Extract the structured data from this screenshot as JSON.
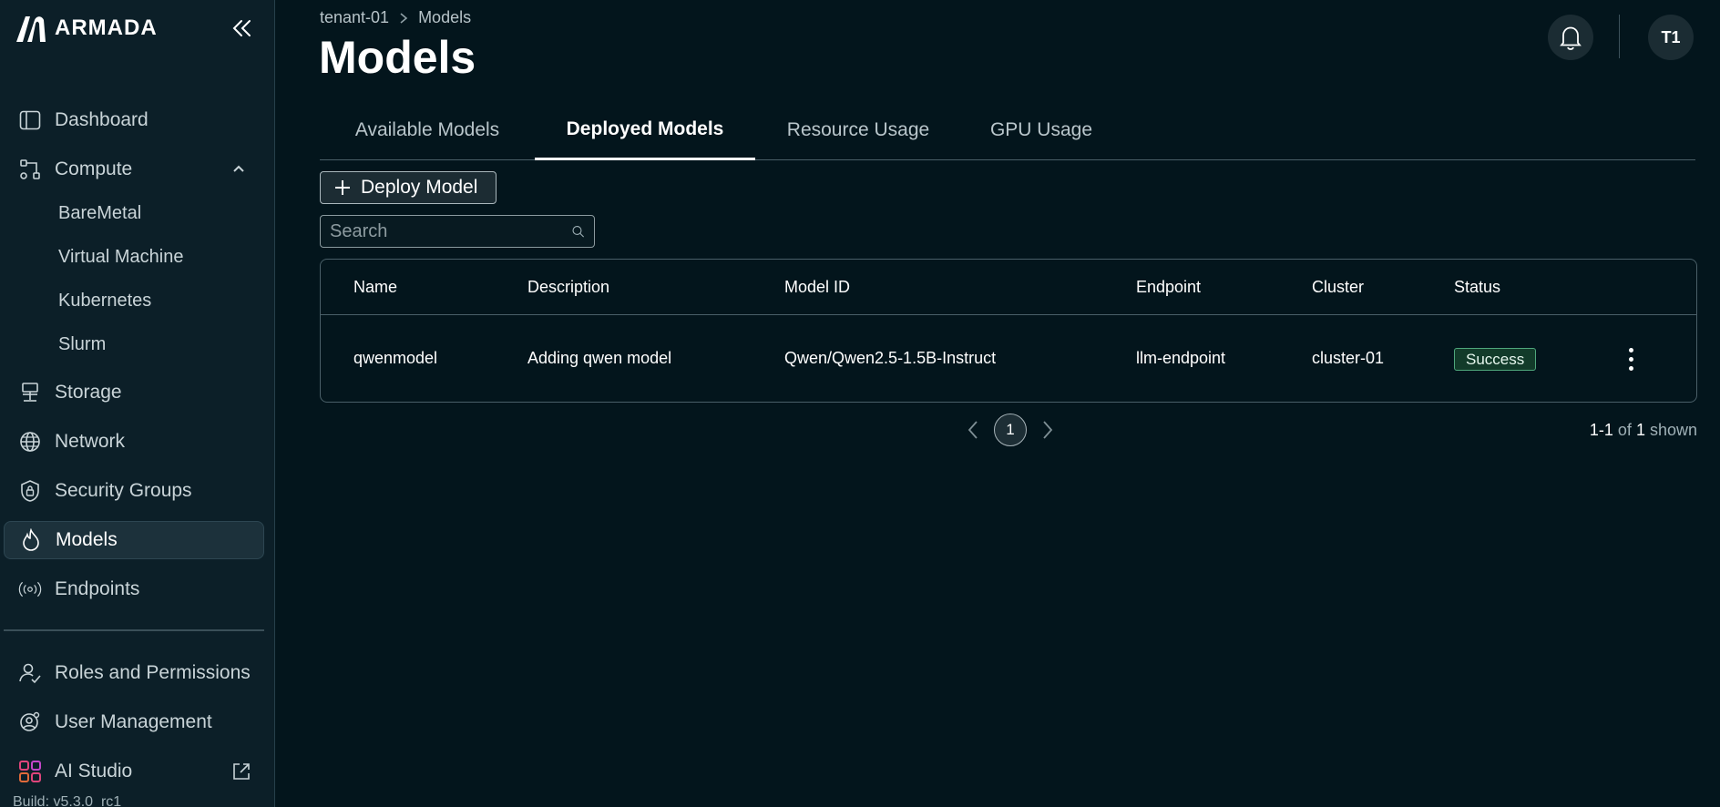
{
  "brand": {
    "name": "ARMADA"
  },
  "sidebar": {
    "items": [
      {
        "label": "Dashboard",
        "icon": "dashboard-icon"
      },
      {
        "label": "Compute",
        "icon": "compute-icon"
      },
      {
        "label": "Storage",
        "icon": "storage-icon"
      },
      {
        "label": "Network",
        "icon": "globe-icon"
      },
      {
        "label": "Security Groups",
        "icon": "shield-icon"
      },
      {
        "label": "Models",
        "icon": "flame-icon"
      },
      {
        "label": "Endpoints",
        "icon": "broadcast-icon"
      },
      {
        "label": "Roles and Permissions",
        "icon": "users-icon"
      },
      {
        "label": "User Management",
        "icon": "user-gear-icon"
      },
      {
        "label": "AI Studio",
        "icon": "ai-studio-icon"
      }
    ],
    "compute_sub": [
      "BareMetal",
      "Virtual Machine",
      "Kubernetes",
      "Slurm"
    ],
    "active": "Models",
    "build": "Build: v5.3.0_rc1"
  },
  "breadcrumb": {
    "tenant": "tenant-01",
    "current": "Models"
  },
  "page": {
    "title": "Models"
  },
  "header": {
    "avatar_initials": "T1"
  },
  "tabs": [
    "Available Models",
    "Deployed Models",
    "Resource Usage",
    "GPU Usage"
  ],
  "active_tab": "Deployed Models",
  "toolbar": {
    "deploy_label": "Deploy Model"
  },
  "search": {
    "placeholder": "Search"
  },
  "table": {
    "columns": [
      "Name",
      "Description",
      "Model ID",
      "Endpoint",
      "Cluster",
      "Status"
    ],
    "rows": [
      {
        "name": "qwenmodel",
        "description": "Adding qwen model",
        "model_id": "Qwen/Qwen2.5-1.5B-Instruct",
        "endpoint": "llm-endpoint",
        "cluster": "cluster-01",
        "status": "Success"
      }
    ]
  },
  "pagination": {
    "current_page": "1",
    "range": "1-1",
    "of_label": "of",
    "total": "1",
    "suffix": "shown"
  },
  "colors": {
    "background": "#03151c",
    "sidebar": "#0c1f28",
    "success": "#4fa77c"
  }
}
